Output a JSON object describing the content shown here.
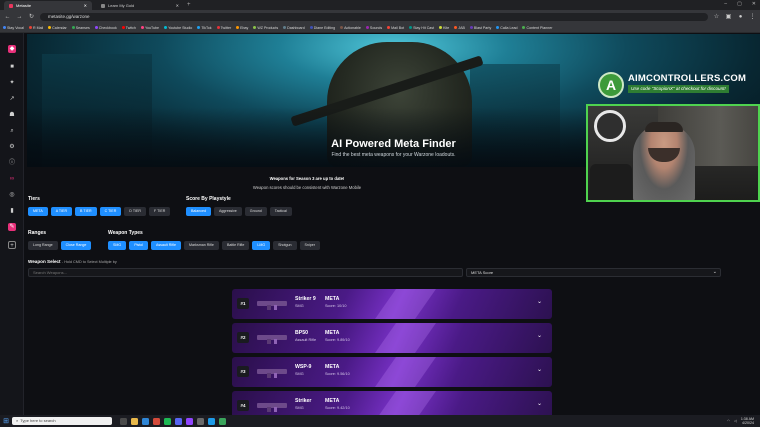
{
  "browser": {
    "tabs": [
      {
        "title": "Metasite",
        "active": true
      },
      {
        "title": "Learn My Gold",
        "active": false
      }
    ],
    "url": "metasite.gg/warzone",
    "bookmarks": [
      "Stay Vocal",
      "R Mail",
      "Calendar",
      "Seanses",
      "Checkbook",
      "Twitch",
      "YouTube",
      "Youtube Studio",
      "TikTok",
      "Twitter",
      "Ebay",
      "WZ Products",
      "Dashboard",
      "Diane Editing",
      "Actionable",
      "Sounds",
      "Mail Bot",
      "Stay Hit Cast",
      "Kite",
      "JAB",
      "Blast Party",
      "Calla Lead",
      "Content Planner"
    ]
  },
  "hero": {
    "title": "AI Powered Meta Finder",
    "subtitle": "Find the best meta weapons for your Warzone loadouts."
  },
  "promo": {
    "brand": "AIMCONTROLLERS.COM",
    "code_text": "Use code \"ScopionX\" at checkout for discount!"
  },
  "notices": {
    "line1": "Weapons for Season 3 are up to date!",
    "line2": "Weapon scores should be consistent with Warzone Mobile"
  },
  "filters": {
    "tiers_label": "Tiers",
    "tiers": [
      {
        "label": "META",
        "on": true
      },
      {
        "label": "A TIER",
        "on": true
      },
      {
        "label": "B TIER",
        "on": true
      },
      {
        "label": "C TIER",
        "on": true
      },
      {
        "label": "D TIER",
        "on": false
      },
      {
        "label": "F TIER",
        "on": false
      }
    ],
    "playstyle_label": "Score By Playstyle",
    "playstyles": [
      {
        "label": "Balanced",
        "on": true
      },
      {
        "label": "Aggressive",
        "on": false
      },
      {
        "label": "Ground",
        "on": false
      },
      {
        "label": "Tactical",
        "on": false
      }
    ],
    "ranges_label": "Ranges",
    "ranges": [
      {
        "label": "Long Range",
        "on": false
      },
      {
        "label": "Close Range",
        "on": true
      }
    ],
    "types_label": "Weapon Types",
    "types": [
      {
        "label": "SMG",
        "on": true
      },
      {
        "label": "Pistol",
        "on": true
      },
      {
        "label": "Assault Rifle",
        "on": true
      },
      {
        "label": "Marksman Rifle",
        "on": false
      },
      {
        "label": "Battle Rifle",
        "on": false
      },
      {
        "label": "LMG",
        "on": true
      },
      {
        "label": "Shotgun",
        "on": false
      },
      {
        "label": "Sniper",
        "on": false
      }
    ]
  },
  "weapon_select": {
    "label": "Weapon Select",
    "hint": "- Hold CMD to Select Multiple by",
    "search_placeholder": "Search Weapons...",
    "sort_value": "META Score"
  },
  "weapons": [
    {
      "rank": "#1",
      "name": "Striker 9",
      "class": "SMG",
      "tier": "META",
      "score": "Score: 10/10"
    },
    {
      "rank": "#2",
      "name": "BP50",
      "class": "Assault Rifle",
      "tier": "META",
      "score": "Score: 9.89/10"
    },
    {
      "rank": "#3",
      "name": "WSP-9",
      "class": "SMG",
      "tier": "META",
      "score": "Score: 9.56/10"
    },
    {
      "rank": "#4",
      "name": "Striker",
      "class": "SMG",
      "tier": "META",
      "score": "Score: 9.42/10"
    }
  ],
  "taskbar": {
    "search_placeholder": "Type here to search",
    "time": "1:38 AM",
    "date": "4/20/24"
  }
}
